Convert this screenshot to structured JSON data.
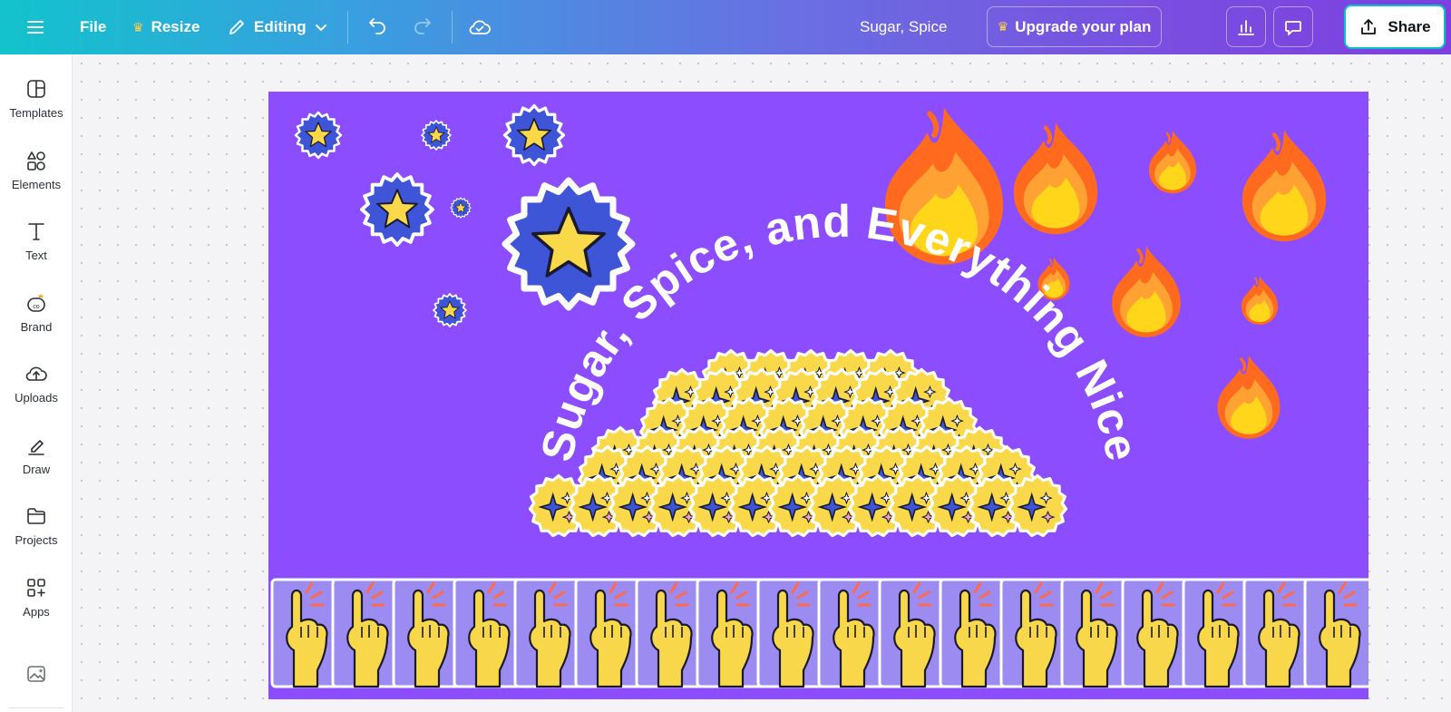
{
  "topbar": {
    "file_label": "File",
    "resize_label": "Resize",
    "editing_label": "Editing",
    "doc_title": "Sugar, Spice",
    "upgrade_label": "Upgrade your plan",
    "share_label": "Share"
  },
  "sidebar": {
    "items": [
      {
        "label": "Templates",
        "icon": "templates-icon"
      },
      {
        "label": "Elements",
        "icon": "elements-icon"
      },
      {
        "label": "Text",
        "icon": "text-icon"
      },
      {
        "label": "Brand",
        "icon": "brand-icon"
      },
      {
        "label": "Uploads",
        "icon": "uploads-icon"
      },
      {
        "label": "Draw",
        "icon": "draw-icon"
      },
      {
        "label": "Projects",
        "icon": "projects-icon"
      },
      {
        "label": "Apps",
        "icon": "apps-icon"
      }
    ]
  },
  "canvas": {
    "curved_text": "Sugar, Spice, and Everything Nice",
    "background_color": "#8b4dfe"
  },
  "colors": {
    "star_badge_blue": "#3d55d6",
    "star_yellow": "#f9d84a",
    "flame_orange": "#ff6a1f",
    "flame_yellow": "#ffd61a",
    "card_purple": "#9c8cf2",
    "hand_yellow": "#f8d84a"
  }
}
